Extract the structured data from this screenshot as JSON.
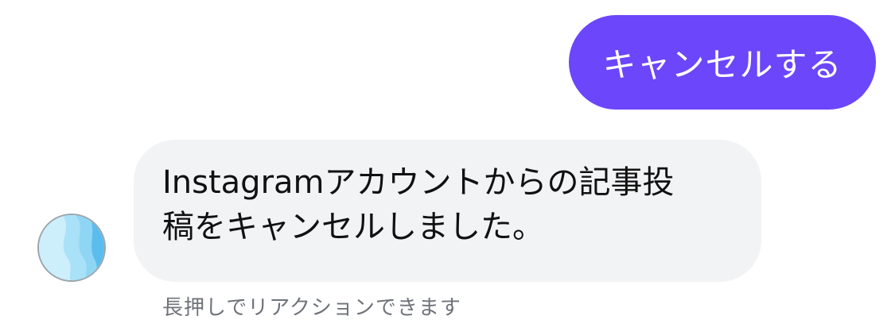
{
  "colors": {
    "outgoing_bubble": "#6b46fb",
    "incoming_bubble": "#f2f3f5",
    "incoming_text": "#111111",
    "hint_text": "#6f737a",
    "avatar_light": "#cdeefb",
    "avatar_mid": "#8fd6f5",
    "avatar_dark": "#5bbdee"
  },
  "outgoing_message": {
    "text": "キャンセルする"
  },
  "incoming_message": {
    "line1": "Instagramアカウントからの記事投",
    "line2": "稿をキャンセルしました。"
  },
  "avatar": {
    "icon": "bot-avatar-icon"
  },
  "hint": {
    "text": "長押しでリアクションできます"
  }
}
